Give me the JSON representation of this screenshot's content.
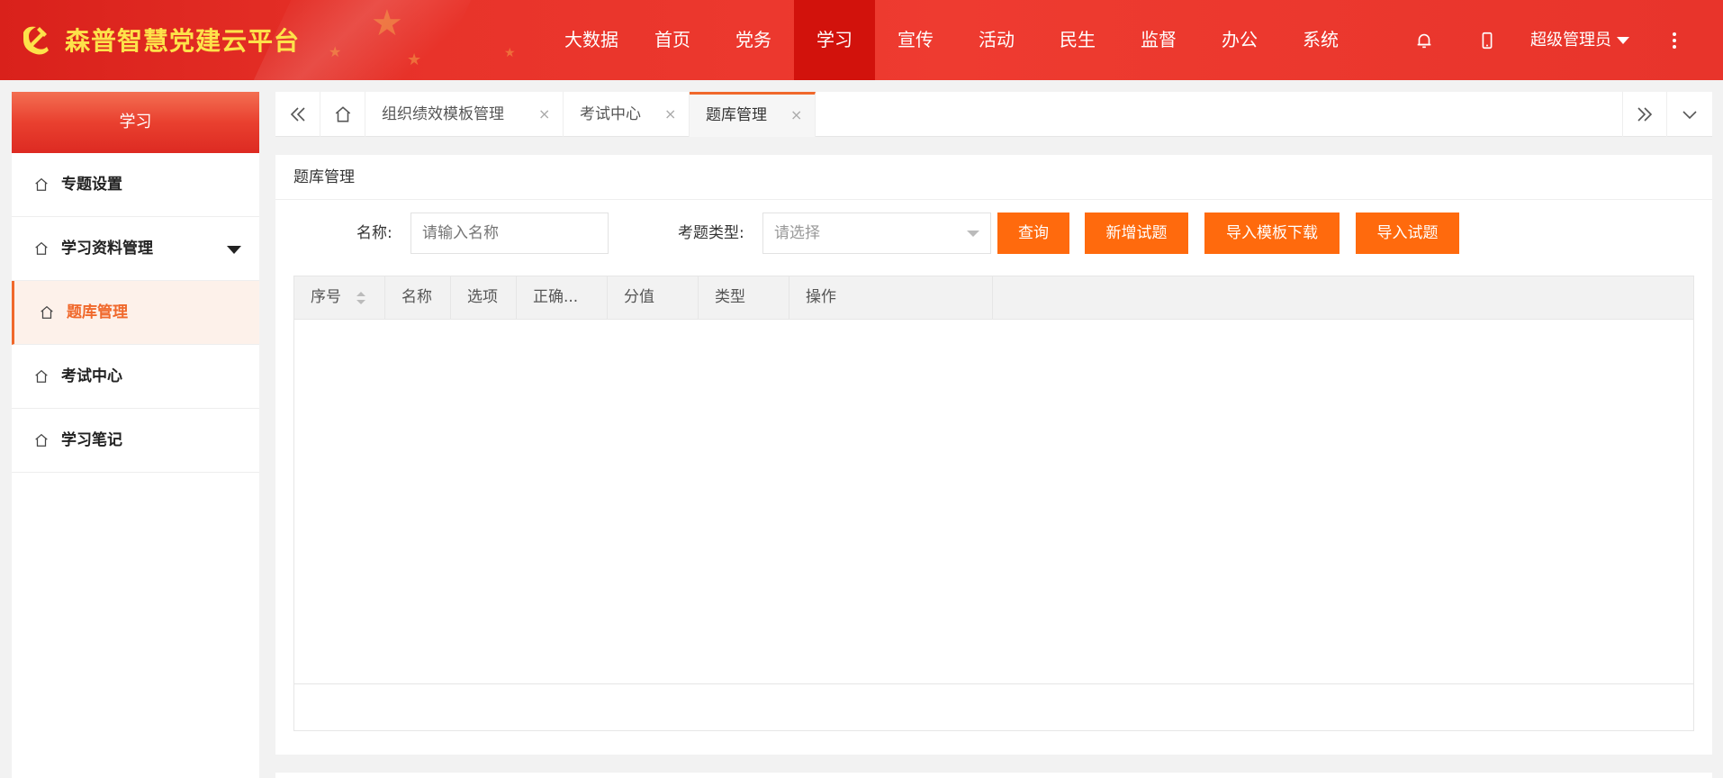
{
  "app": {
    "title": "森普智慧党建云平台"
  },
  "colors": {
    "header_red": "#e8332a",
    "nav_active": "#d2120c",
    "accent_orange": "#ff6a0d",
    "logo_yellow": "#fde24a"
  },
  "nav": {
    "items": [
      {
        "label": "大数据"
      },
      {
        "label": "首页"
      },
      {
        "label": "党务"
      },
      {
        "label": "学习",
        "active": true
      },
      {
        "label": "宣传"
      },
      {
        "label": "活动"
      },
      {
        "label": "民生"
      },
      {
        "label": "监督"
      },
      {
        "label": "办公"
      },
      {
        "label": "系统"
      }
    ],
    "icons": [
      "bell-icon",
      "mobile-icon",
      "more-vertical-icon"
    ],
    "user": "超级管理员"
  },
  "sidebar": {
    "title": "学习",
    "items": [
      {
        "label": "专题设置"
      },
      {
        "label": "学习资料管理",
        "has_dropdown": true
      },
      {
        "label": "题库管理",
        "active": true
      },
      {
        "label": "考试中心"
      },
      {
        "label": "学习笔记"
      }
    ]
  },
  "tabs": {
    "items": [
      {
        "label": "组织绩效模板管理"
      },
      {
        "label": "考试中心"
      },
      {
        "label": "题库管理",
        "active": true
      }
    ],
    "close_glyph": "×"
  },
  "main": {
    "title": "题库管理",
    "filters": {
      "name_label": "名称:",
      "name_placeholder": "请输入名称",
      "type_label": "考题类型:",
      "type_value": "请选择"
    },
    "buttons": {
      "query": "查询",
      "add": "新增试题",
      "template_download": "导入模板下载",
      "import": "导入试题"
    },
    "table": {
      "columns": [
        "序号",
        "名称",
        "选项",
        "正确...",
        "分值",
        "类型",
        "操作"
      ],
      "rows": []
    }
  }
}
